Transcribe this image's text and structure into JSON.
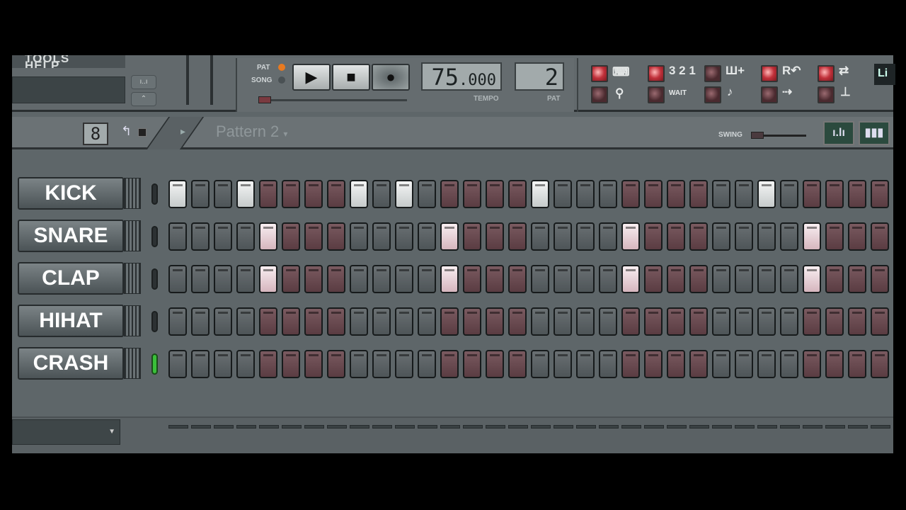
{
  "menu": {
    "items": [
      "TOOLS",
      "HELP"
    ]
  },
  "transport": {
    "pat_label": "PAT",
    "song_label": "SONG",
    "mode": "PAT",
    "tempo": "75",
    "tempo_decimals": ".000",
    "tempo_label": "TEMPO",
    "pattern_number": "2",
    "pattern_label": "PAT"
  },
  "options": {
    "icons": [
      "typing-keyboard-icon",
      "countdown-321-icon",
      "step-edit-icon",
      "recording-loop-icon",
      "blend-notes-icon",
      "metronome-icon",
      "wait-for-input-icon",
      "foot-pedal-icon",
      "step-through-icon",
      "joystick-icon"
    ],
    "states_top": [
      true,
      true,
      false,
      true,
      true
    ],
    "states_bottom": [
      false,
      false,
      false,
      false,
      false
    ],
    "labels": {
      "countdown": "3 2 1",
      "wait": "WAIT",
      "loop": "R↶"
    },
    "right_label": "Li"
  },
  "pattern_bar": {
    "steps_value": "8",
    "pattern_name": "Pattern 2",
    "swing_label": "SWING",
    "swing_value": 0
  },
  "colors": {
    "step_gray": "#5b6265",
    "step_red": "#6a4a50",
    "step_on": "#e8eaea",
    "led_on": "#3ac03a"
  },
  "channels": [
    {
      "name": "KICK",
      "led": false,
      "steps": [
        1,
        4,
        9,
        11,
        17,
        27
      ]
    },
    {
      "name": "SNARE",
      "led": false,
      "steps": [
        5,
        13,
        21,
        29
      ]
    },
    {
      "name": "CLAP",
      "led": false,
      "steps": [
        5,
        13,
        21,
        29
      ]
    },
    {
      "name": "HIHAT",
      "led": false,
      "steps": []
    },
    {
      "name": "CRASH",
      "led": true,
      "steps": []
    }
  ],
  "step_count": 32
}
